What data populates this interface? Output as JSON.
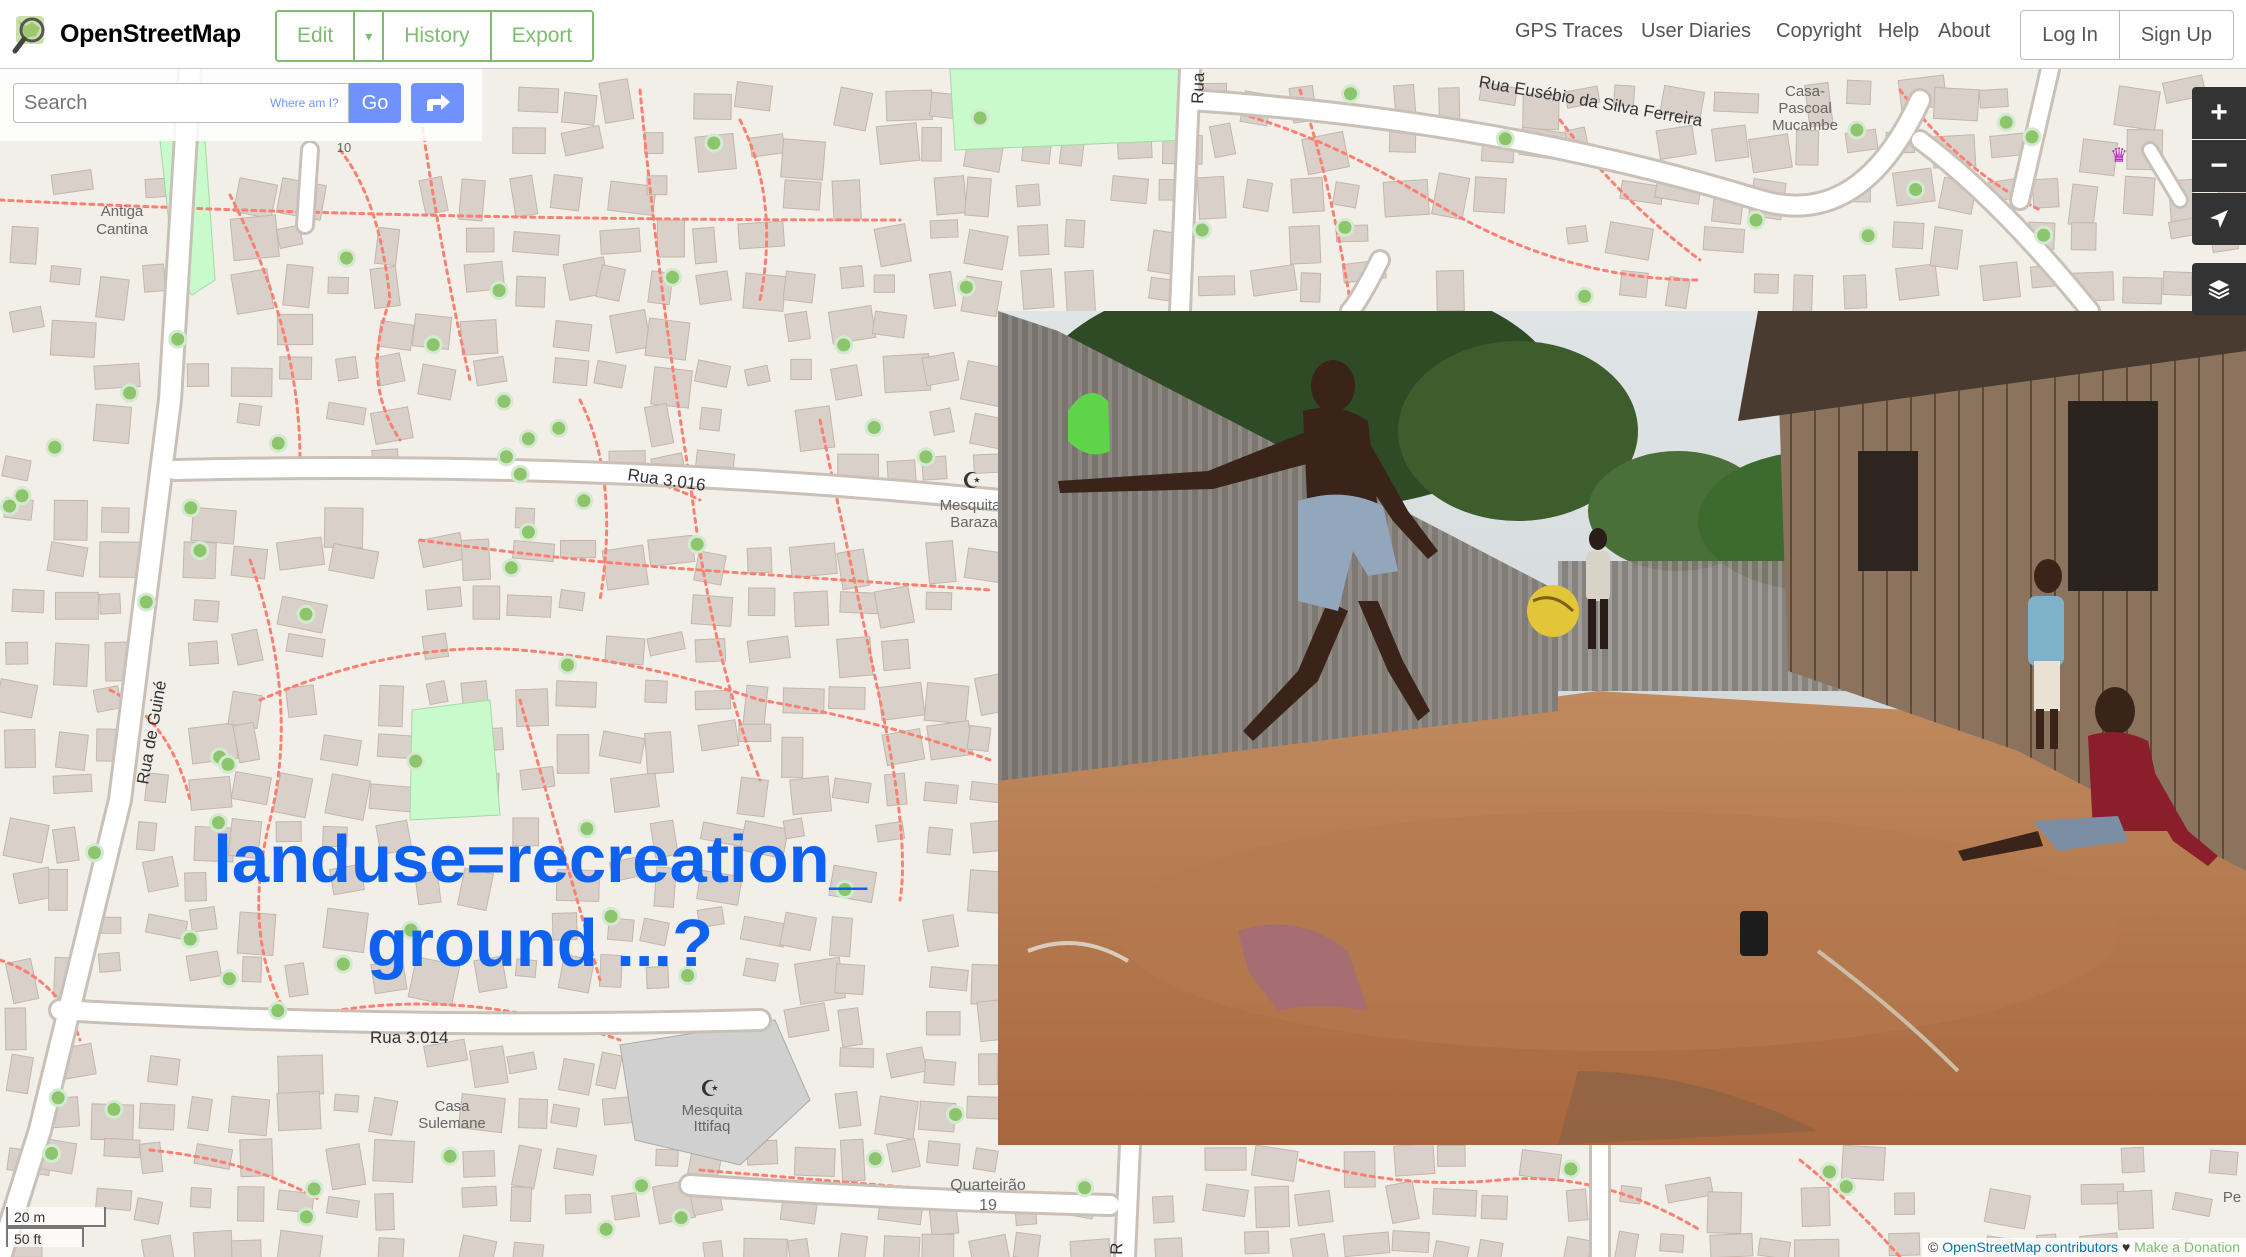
{
  "app": {
    "name": "OpenStreetMap"
  },
  "header": {
    "edit_label": "Edit",
    "history_label": "History",
    "export_label": "Export",
    "nav": [
      "GPS Traces",
      "User Diaries",
      "Copyright",
      "Help",
      "About"
    ],
    "login_label": "Log In",
    "signup_label": "Sign Up"
  },
  "search": {
    "placeholder": "Search",
    "where_am_i": "Where am I?",
    "go_label": "Go"
  },
  "map": {
    "labels": {
      "rua_3016": "Rua 3.016",
      "rua_3014": "Rua 3.014",
      "rua_de_guine": "Rua de Guiné",
      "rua_eusebio": "Rua Eusébio da Silva Ferreira",
      "rua_top": "Rua",
      "antiga_cantina_1": "Antiga",
      "antiga_cantina_2": "Cantina",
      "mesquita_baraza_1": "Mesquita",
      "mesquita_baraza_2": "Baraza",
      "casa_pascoal_1": "Casa-",
      "casa_pascoal_2": "Pascoal",
      "casa_pascoal_3": "Mucambe",
      "casa_sulemane_1": "Casa",
      "casa_sulemane_2": "Sulemane",
      "mesquita_ittifaq_1": "Mesquita",
      "mesquita_ittifaq_2": "Ittifaq",
      "quarteirao_1": "Quarteirão",
      "quarteirao_2": "19",
      "house_number": "10",
      "edge_label_right": "Pe",
      "edge_label_bottom_right": "R"
    },
    "colors": {
      "background": "#f2efe9",
      "building": "#d9d0c9",
      "building_outline": "#c4b6ab",
      "road": "#ffffff",
      "path": "#fa8072",
      "park": "#c8facc",
      "tree": "#8dc56c"
    }
  },
  "controls": {
    "zoom_in": "plus-icon",
    "zoom_out": "minus-icon",
    "locate": "locate-icon",
    "layers": "layers-icon"
  },
  "caption": {
    "line1": "landuse=recreation_",
    "line2": "ground ...?"
  },
  "scale": {
    "metric": "20 m",
    "imperial": "50 ft"
  },
  "attribution": {
    "prefix": "©",
    "osm_contributors": "OpenStreetMap contributors",
    "heart": "♥",
    "donate": "Make a Donation"
  }
}
